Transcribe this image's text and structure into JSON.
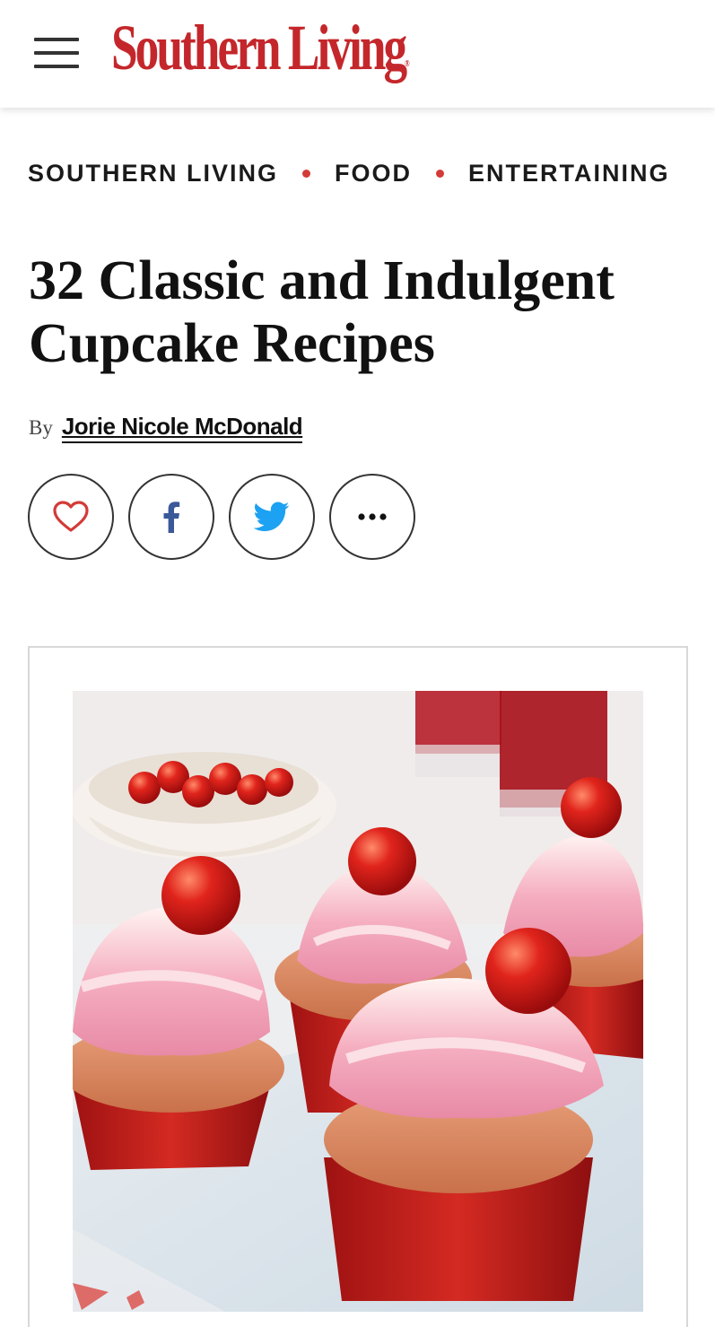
{
  "header": {
    "logo": "Southern Living",
    "logo_mark": "®"
  },
  "breadcrumb": [
    "SOUTHERN LIVING",
    "FOOD",
    "ENTERTAINING"
  ],
  "article": {
    "title": "32 Classic and Indulgent Cupcake Recipes",
    "by_label": "By",
    "author": "Jorie Nicole McDonald"
  },
  "share": [
    {
      "name": "save-heart-icon",
      "color": "#d23b37"
    },
    {
      "name": "facebook-icon",
      "color": "#3b5998"
    },
    {
      "name": "twitter-icon",
      "color": "#1da1f2"
    },
    {
      "name": "more-options-icon",
      "color": "#111111"
    }
  ],
  "colors": {
    "brand_red": "#c4272b",
    "dot_red": "#d23b37"
  }
}
